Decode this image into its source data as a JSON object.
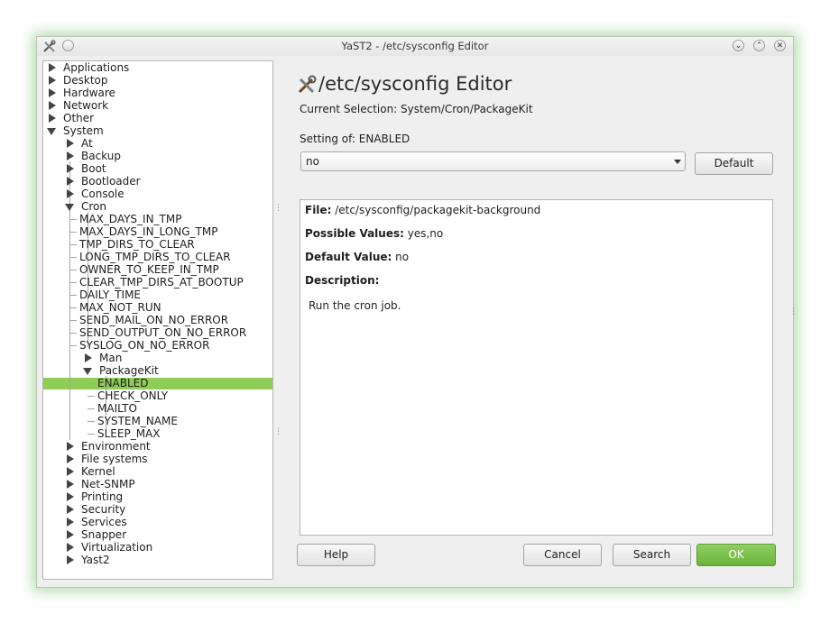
{
  "window": {
    "title": "YaST2 - /etc/sysconfig Editor",
    "accent_color": "#8fcd57"
  },
  "tree": {
    "items": [
      {
        "label": "Applications",
        "level": 0,
        "state": "collapsed"
      },
      {
        "label": "Desktop",
        "level": 0,
        "state": "collapsed"
      },
      {
        "label": "Hardware",
        "level": 0,
        "state": "collapsed"
      },
      {
        "label": "Network",
        "level": 0,
        "state": "collapsed"
      },
      {
        "label": "Other",
        "level": 0,
        "state": "collapsed"
      },
      {
        "label": "System",
        "level": 0,
        "state": "expanded"
      },
      {
        "label": "At",
        "level": 1,
        "state": "collapsed"
      },
      {
        "label": "Backup",
        "level": 1,
        "state": "collapsed"
      },
      {
        "label": "Boot",
        "level": 1,
        "state": "collapsed"
      },
      {
        "label": "Bootloader",
        "level": 1,
        "state": "collapsed"
      },
      {
        "label": "Console",
        "level": 1,
        "state": "collapsed"
      },
      {
        "label": "Cron",
        "level": 1,
        "state": "expanded"
      },
      {
        "label": "MAX_DAYS_IN_TMP",
        "level": 2,
        "state": "leaf"
      },
      {
        "label": "MAX_DAYS_IN_LONG_TMP",
        "level": 2,
        "state": "leaf"
      },
      {
        "label": "TMP_DIRS_TO_CLEAR",
        "level": 2,
        "state": "leaf"
      },
      {
        "label": "LONG_TMP_DIRS_TO_CLEAR",
        "level": 2,
        "state": "leaf"
      },
      {
        "label": "OWNER_TO_KEEP_IN_TMP",
        "level": 2,
        "state": "leaf"
      },
      {
        "label": "CLEAR_TMP_DIRS_AT_BOOTUP",
        "level": 2,
        "state": "leaf"
      },
      {
        "label": "DAILY_TIME",
        "level": 2,
        "state": "leaf"
      },
      {
        "label": "MAX_NOT_RUN",
        "level": 2,
        "state": "leaf"
      },
      {
        "label": "SEND_MAIL_ON_NO_ERROR",
        "level": 2,
        "state": "leaf"
      },
      {
        "label": "SEND_OUTPUT_ON_NO_ERROR",
        "level": 2,
        "state": "leaf"
      },
      {
        "label": "SYSLOG_ON_NO_ERROR",
        "level": 2,
        "state": "leaf"
      },
      {
        "label": "Man",
        "level": 2,
        "state": "collapsed"
      },
      {
        "label": "PackageKit",
        "level": 2,
        "state": "expanded"
      },
      {
        "label": "ENABLED",
        "level": 3,
        "state": "leaf",
        "selected": true
      },
      {
        "label": "CHECK_ONLY",
        "level": 3,
        "state": "leaf"
      },
      {
        "label": "MAILTO",
        "level": 3,
        "state": "leaf"
      },
      {
        "label": "SYSTEM_NAME",
        "level": 3,
        "state": "leaf"
      },
      {
        "label": "SLEEP_MAX",
        "level": 3,
        "state": "leaf"
      },
      {
        "label": "Environment",
        "level": 1,
        "state": "collapsed"
      },
      {
        "label": "File systems",
        "level": 1,
        "state": "collapsed"
      },
      {
        "label": "Kernel",
        "level": 1,
        "state": "collapsed"
      },
      {
        "label": "Net-SNMP",
        "level": 1,
        "state": "collapsed"
      },
      {
        "label": "Printing",
        "level": 1,
        "state": "collapsed"
      },
      {
        "label": "Security",
        "level": 1,
        "state": "collapsed"
      },
      {
        "label": "Services",
        "level": 1,
        "state": "collapsed"
      },
      {
        "label": "Snapper",
        "level": 1,
        "state": "collapsed"
      },
      {
        "label": "Virtualization",
        "level": 1,
        "state": "collapsed"
      },
      {
        "label": "Yast2",
        "level": 1,
        "state": "collapsed"
      }
    ]
  },
  "editor": {
    "heading": "/etc/sysconfig Editor",
    "current_selection": "Current Selection: System/Cron/PackageKit",
    "setting_of": "Setting of: ENABLED",
    "value": "no",
    "default_button": "Default"
  },
  "info": {
    "file_label": "File:",
    "file_value": "/etc/sysconfig/packagekit-background",
    "possible_label": "Possible Values:",
    "possible_value": "yes,no",
    "default_label": "Default Value:",
    "default_value": "no",
    "description_label": "Description:",
    "description_text": "Run the cron job."
  },
  "buttons": {
    "help": "Help",
    "cancel": "Cancel",
    "search": "Search",
    "ok": "OK"
  }
}
